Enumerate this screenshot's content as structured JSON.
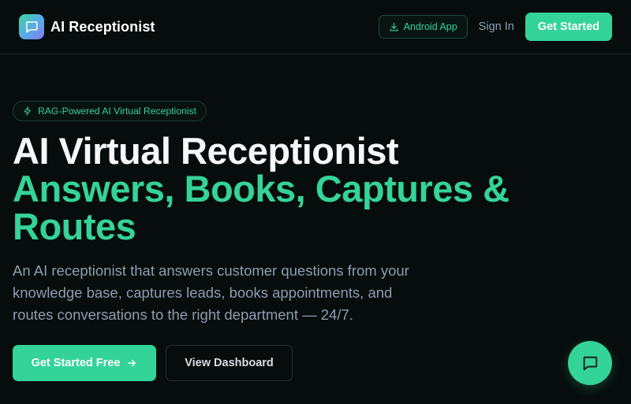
{
  "header": {
    "brand_name": "AI Receptionist",
    "android_label": "Android App",
    "signin_label": "Sign In",
    "get_started_label": "Get Started"
  },
  "hero": {
    "badge": "RAG-Powered AI Virtual Receptionist",
    "title_line1": "AI Virtual Receptionist",
    "title_line2": "Answers, Books, Captures & Routes",
    "description": "An AI receptionist that answers customer questions from your knowledge base, captures leads, books appointments, and routes conversations to the right department — 24/7.",
    "primary_cta": "Get Started Free",
    "secondary_cta": "View Dashboard"
  },
  "icons": {
    "logo": "chat-bubble-icon",
    "android": "download-icon",
    "badge": "lightning-icon",
    "cta_arrow": "arrow-right-icon",
    "fab": "chat-bubble-icon"
  },
  "colors": {
    "accent": "#34d399",
    "background": "#070d0c",
    "muted_text": "#8e9db0"
  }
}
